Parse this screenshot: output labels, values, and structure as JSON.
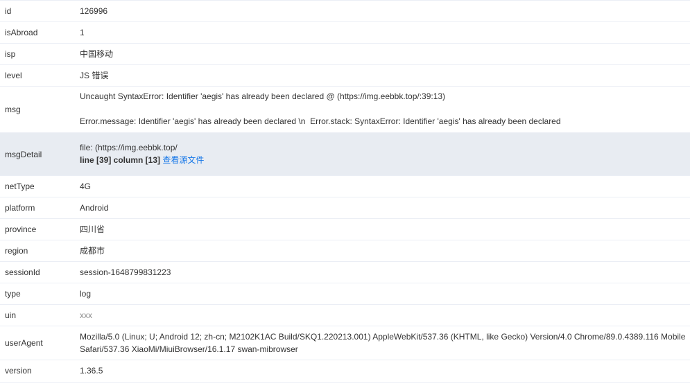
{
  "rows": {
    "id": {
      "key": "id",
      "value": "126996"
    },
    "isAbroad": {
      "key": "isAbroad",
      "value": "1"
    },
    "isp": {
      "key": "isp",
      "value": "中国移动"
    },
    "level": {
      "key": "level",
      "value": "JS 错误"
    },
    "msg": {
      "key": "msg",
      "line1": "Uncaught SyntaxError: Identifier 'aegis' has already been declared @ (https://img.eebbk.top/:39:13)",
      "line2": "Error.message: Identifier 'aegis' has already been declared \\n  Error.stack: SyntaxError: Identifier 'aegis' has already been declared"
    },
    "msgDetail": {
      "key": "msgDetail",
      "file": "file: (https://img.eebbk.top/",
      "position": "line [39] column [13]",
      "link": "查看源文件"
    },
    "netType": {
      "key": "netType",
      "value": "4G"
    },
    "platform": {
      "key": "platform",
      "value": "Android"
    },
    "province": {
      "key": "province",
      "value": "四川省"
    },
    "region": {
      "key": "region",
      "value": "成都市"
    },
    "sessionId": {
      "key": "sessionId",
      "value": "session-1648799831223"
    },
    "type": {
      "key": "type",
      "value": "log"
    },
    "uin": {
      "key": "uin",
      "value": "xxx"
    },
    "userAgent": {
      "key": "userAgent",
      "value": "Mozilla/5.0 (Linux; U; Android 12; zh-cn; M2102K1AC Build/SKQ1.220213.001) AppleWebKit/537.36 (KHTML, like Gecko) Version/4.0 Chrome/89.0.4389.116 Mobile Safari/537.36 XiaoMi/MiuiBrowser/16.1.17 swan-mibrowser"
    },
    "version": {
      "key": "version",
      "value": "1.36.5"
    }
  },
  "colors": {
    "link": "#1677e8",
    "highlight_row": "#e8ecf2",
    "border": "#ebeef5",
    "text": "#333333"
  }
}
